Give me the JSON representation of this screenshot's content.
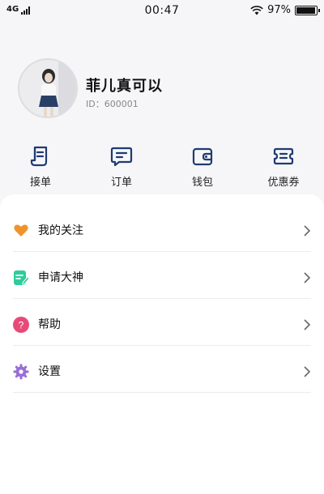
{
  "status_bar": {
    "network": "4G",
    "time": "00:47",
    "battery": "97%",
    "battery_level": 0.97
  },
  "profile": {
    "nickname": "菲儿真可以",
    "user_id": "ID：600001"
  },
  "quick_actions": [
    {
      "label": "接单",
      "icon": "scroll-icon"
    },
    {
      "label": "订单",
      "icon": "message-list-icon"
    },
    {
      "label": "钱包",
      "icon": "wallet-icon"
    },
    {
      "label": "优惠券",
      "icon": "coupon-icon"
    }
  ],
  "menu": [
    {
      "label": "我的关注",
      "icon": "heart-icon",
      "color": "#f0932b"
    },
    {
      "label": "申请大神",
      "icon": "edit-form-icon",
      "color": "#2ecc9a"
    },
    {
      "label": "帮助",
      "icon": "question-icon",
      "color": "#e84a78"
    },
    {
      "label": "设置",
      "icon": "gear-icon",
      "color": "#9b6dd6"
    }
  ],
  "colors": {
    "accent": "#1f3b73",
    "background": "#f6f6f8"
  }
}
